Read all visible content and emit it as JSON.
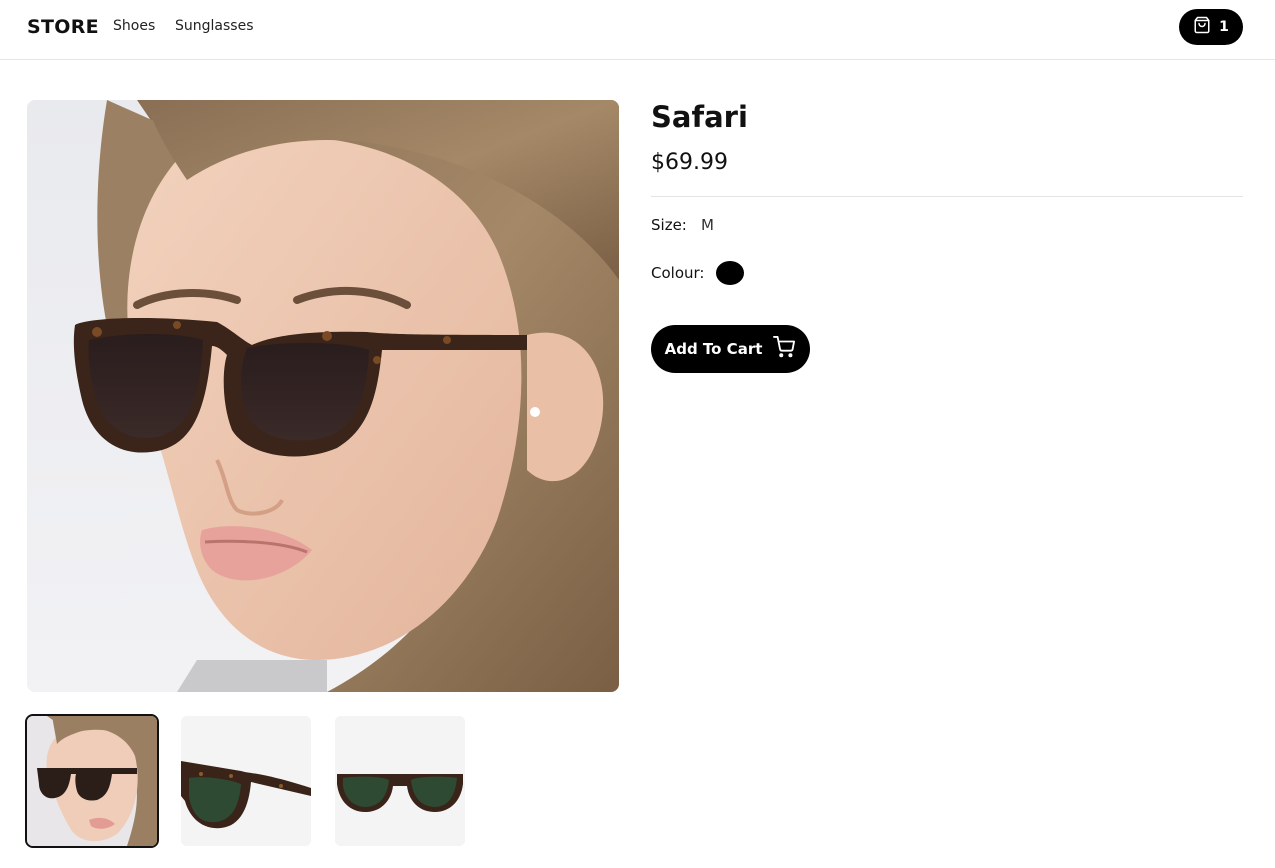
{
  "header": {
    "logo": "STORE",
    "nav": [
      {
        "label": "Shoes"
      },
      {
        "label": "Sunglasses"
      }
    ],
    "cart": {
      "icon": "shopping-bag-icon",
      "count": "1"
    }
  },
  "product": {
    "title": "Safari",
    "price": "$69.99",
    "size_label": "Size:",
    "size_value": "M",
    "colour_label": "Colour:",
    "colour_swatch": "#000000",
    "add_to_cart_label": "Add To Cart",
    "add_to_cart_icon": "shopping-cart-icon"
  },
  "gallery": {
    "selected_index": 0,
    "thumbnails": [
      {
        "subject": "model wearing tortoiseshell sunglasses"
      },
      {
        "subject": "sunglasses side view"
      },
      {
        "subject": "sunglasses front view"
      }
    ]
  }
}
